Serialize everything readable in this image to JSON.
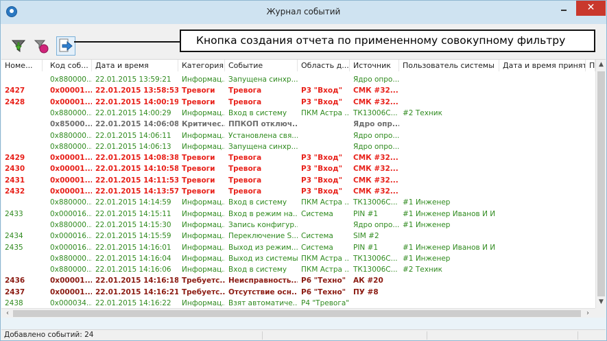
{
  "window": {
    "title": "Журнал событий"
  },
  "toolbar": {
    "callout": "Кнопка создания отчета по примененному совокупному фильтру",
    "buttons": [
      "filter-funnel-icon",
      "clear-filter-icon",
      "report-arrow-icon"
    ]
  },
  "columns": [
    "Номе...",
    "Код соб...",
    "Дата и время",
    "Категория",
    "Событие",
    "Область д...",
    "Источник",
    "Пользователь системы",
    "Дата и время принят...",
    "П"
  ],
  "rows": [
    {
      "type": "info",
      "cells": [
        "",
        "0x880000...",
        "22.01.2015 13:59:21",
        "Информац...",
        "Запущена синхр...",
        "",
        "Ядро опро...",
        "",
        "",
        ""
      ]
    },
    {
      "type": "alarm",
      "cells": [
        "2427",
        "0x00001...",
        "22.01.2015 13:58:53",
        "Тревоги",
        "Тревога",
        "Р3 \"Вход\"",
        "СМК #32...",
        "",
        "",
        ""
      ]
    },
    {
      "type": "alarm",
      "cells": [
        "2428",
        "0x00001...",
        "22.01.2015 14:00:19",
        "Тревоги",
        "Тревога",
        "Р3 \"Вход\"",
        "СМК #32...",
        "",
        "",
        ""
      ]
    },
    {
      "type": "info",
      "cells": [
        "",
        "0x880000...",
        "22.01.2015 14:00:29",
        "Информац...",
        "Вход в систему",
        "ПКМ Астра ...",
        "ТК13006С...",
        "#2 Техник",
        "",
        ""
      ]
    },
    {
      "type": "crit",
      "cells": [
        "",
        "0x85000...",
        "22.01.2015 14:06:08",
        "Критичес...",
        "ППКОП отключ..",
        "",
        "Ядро опр...",
        "",
        "",
        ""
      ]
    },
    {
      "type": "info",
      "cells": [
        "",
        "0x880000...",
        "22.01.2015 14:06:11",
        "Информац...",
        "Установлена свя...",
        "",
        "Ядро опро...",
        "",
        "",
        ""
      ]
    },
    {
      "type": "info",
      "cells": [
        "",
        "0x880000...",
        "22.01.2015 14:06:13",
        "Информац...",
        "Запущена синхр...",
        "",
        "Ядро опро...",
        "",
        "",
        ""
      ]
    },
    {
      "type": "alarm",
      "cells": [
        "2429",
        "0x00001...",
        "22.01.2015 14:08:38",
        "Тревоги",
        "Тревога",
        "Р3 \"Вход\"",
        "СМК #32...",
        "",
        "",
        ""
      ]
    },
    {
      "type": "alarm",
      "cells": [
        "2430",
        "0x00001...",
        "22.01.2015 14:10:58",
        "Тревоги",
        "Тревога",
        "Р3 \"Вход\"",
        "СМК #32...",
        "",
        "",
        ""
      ]
    },
    {
      "type": "alarm",
      "cells": [
        "2431",
        "0x00001...",
        "22.01.2015 14:11:53",
        "Тревоги",
        "Тревога",
        "Р3 \"Вход\"",
        "СМК #32...",
        "",
        "",
        ""
      ]
    },
    {
      "type": "alarm",
      "cells": [
        "2432",
        "0x00001...",
        "22.01.2015 14:13:57",
        "Тревоги",
        "Тревога",
        "Р3 \"Вход\"",
        "СМК #32...",
        "",
        "",
        ""
      ]
    },
    {
      "type": "info",
      "cells": [
        "",
        "0x880000...",
        "22.01.2015 14:14:59",
        "Информац...",
        "Вход в систему",
        "ПКМ Астра ...",
        "ТК13006С...",
        "#1 Инженер",
        "",
        ""
      ]
    },
    {
      "type": "info",
      "cells": [
        "2433",
        "0x000016...",
        "22.01.2015 14:15:11",
        "Информац...",
        "Вход в режим на...",
        "Система",
        "PIN #1",
        "#1 Инженер Иванов И И",
        "",
        ""
      ]
    },
    {
      "type": "info",
      "cells": [
        "",
        "0x880000...",
        "22.01.2015 14:15:30",
        "Информац...",
        "Запись конфигур...",
        "",
        "Ядро опро...",
        "#1 Инженер",
        "",
        ""
      ]
    },
    {
      "type": "info",
      "cells": [
        "2434",
        "0x000016...",
        "22.01.2015 14:15:59",
        "Информац...",
        "Переключение S...",
        "Система",
        "SIM #2",
        "",
        "",
        ""
      ]
    },
    {
      "type": "info",
      "cells": [
        "2435",
        "0x000016...",
        "22.01.2015 14:16:01",
        "Информац...",
        "Выход из режим...",
        "Система",
        "PIN #1",
        "#1 Инженер Иванов И И",
        "",
        ""
      ]
    },
    {
      "type": "info",
      "cells": [
        "",
        "0x880000...",
        "22.01.2015 14:16:04",
        "Информац...",
        "Выход из системы",
        "ПКМ Астра ...",
        "ТК13006С...",
        "#1 Инженер",
        "",
        ""
      ]
    },
    {
      "type": "info",
      "cells": [
        "",
        "0x880000...",
        "22.01.2015 14:16:06",
        "Информац...",
        "Вход в систему",
        "ПКМ Астра ...",
        "ТК13006С...",
        "#2 Техник",
        "",
        ""
      ]
    },
    {
      "type": "fault",
      "cells": [
        "2436",
        "0x00001...",
        "22.01.2015 14:16:18",
        "Требуетс...",
        "Неисправность...",
        "Р6 \"Техно\"",
        "АК #20",
        "",
        "",
        ""
      ]
    },
    {
      "type": "fault",
      "cells": [
        "2437",
        "0x00001...",
        "22.01.2015 14:16:21",
        "Требуетс...",
        "Отсутствие осн...",
        "Р6 \"Техно\"",
        "ПУ #8",
        "",
        "",
        ""
      ]
    },
    {
      "type": "info",
      "cells": [
        "2438",
        "0x000034...",
        "22.01.2015 14:16:22",
        "Информац...",
        "Взят автоматиче...",
        "Р4 \"Тревога\"",
        "",
        "",
        "",
        ""
      ]
    }
  ],
  "statusbar": {
    "text": "Добавлено событий: 24"
  }
}
